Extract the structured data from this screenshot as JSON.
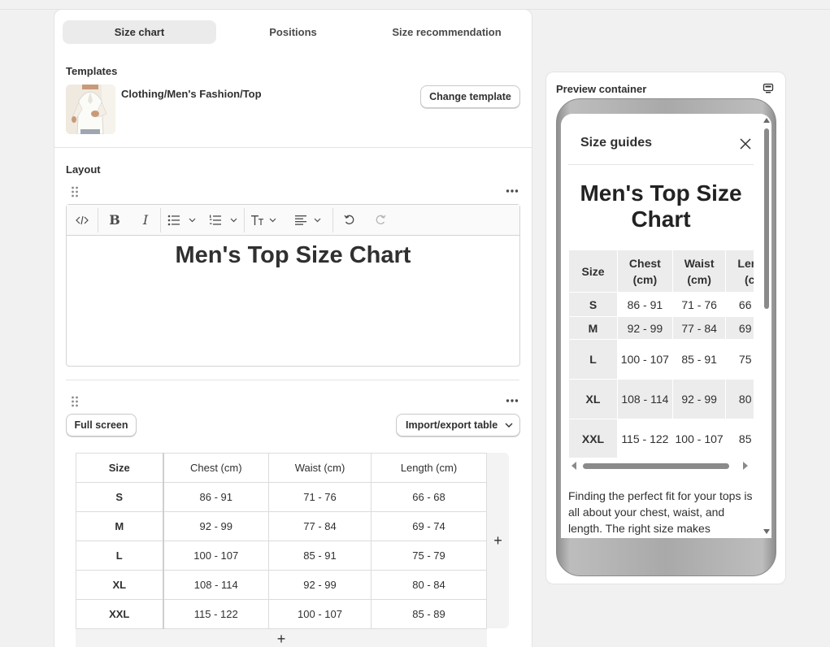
{
  "tabs": [
    {
      "label": "Size chart",
      "active": true
    },
    {
      "label": "Positions",
      "active": false
    },
    {
      "label": "Size recommendation",
      "active": false
    }
  ],
  "templates": {
    "label": "Templates",
    "name": "Clothing/Men's Fashion/Top",
    "change_button": "Change template"
  },
  "layout": {
    "label": "Layout",
    "heading": "Men's Top Size Chart"
  },
  "table_controls": {
    "fullscreen_button": "Full screen",
    "import_export_button": "Import/export table",
    "add_symbol": "+"
  },
  "size_table": {
    "headers": [
      "Size",
      "Chest (cm)",
      "Waist (cm)",
      "Length (cm)"
    ],
    "rows": [
      [
        "S",
        "86 - 91",
        "71 - 76",
        "66 - 68"
      ],
      [
        "M",
        "92 - 99",
        "77 - 84",
        "69 - 74"
      ],
      [
        "L",
        "100 - 107",
        "85 - 91",
        "75 - 79"
      ],
      [
        "XL",
        "108 - 114",
        "92 - 99",
        "80 - 84"
      ],
      [
        "XXL",
        "115 - 122",
        "100 - 107",
        "85 - 89"
      ]
    ]
  },
  "preview": {
    "title": "Preview container",
    "guide_title": "Size guides",
    "heading": "Men's Top Size Chart",
    "table_headers": [
      "Size",
      "Chest (cm)",
      "Waist (cm)",
      "Length (cm)"
    ],
    "description": "Finding the perfect fit for your tops is all about your chest, waist, and length. The right size makes"
  }
}
